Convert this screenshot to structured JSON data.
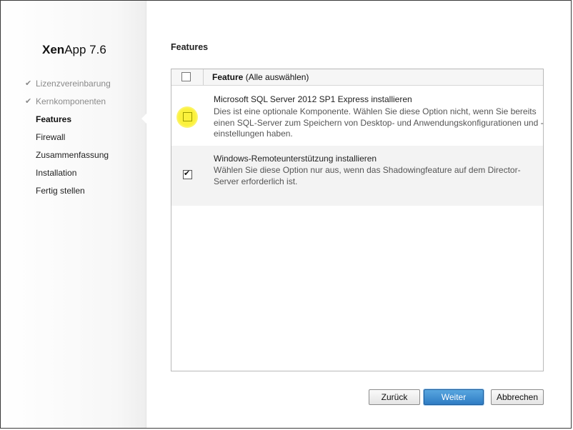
{
  "product": {
    "brand": "Xen",
    "name": "App 7.6"
  },
  "steps": [
    {
      "label": "Lizenzvereinbarung",
      "state": "done"
    },
    {
      "label": "Kernkomponenten",
      "state": "done"
    },
    {
      "label": "Features",
      "state": "current"
    },
    {
      "label": "Firewall",
      "state": "pending"
    },
    {
      "label": "Zusammenfassung",
      "state": "pending"
    },
    {
      "label": "Installation",
      "state": "pending"
    },
    {
      "label": "Fertig stellen",
      "state": "pending"
    }
  ],
  "check_glyph": "✔",
  "page_title": "Features",
  "table": {
    "header_feature": "Feature",
    "header_select_all": "(Alle auswählen)",
    "select_all_checked": false
  },
  "features": [
    {
      "title": "Microsoft SQL Server 2012 SP1 Express installieren",
      "description": "Dies ist eine optionale Komponente. Wählen Sie diese Option nicht, wenn Sie bereits einen SQL-Server zum Speichern von Desktop- und Anwendungskonfigurationen und -einstellungen haben.",
      "checked": false,
      "highlight_color": "#fbf13c"
    },
    {
      "title": "Windows-Remoteunterstützung installieren",
      "description": "Wählen Sie diese Option nur aus, wenn das Shadowingfeature auf dem Director-Server erforderlich ist.",
      "checked": true
    }
  ],
  "buttons": {
    "back": "Zurück",
    "next": "Weiter",
    "cancel": "Abbrechen"
  },
  "colors": {
    "primary_button": "#2f7cc4"
  }
}
